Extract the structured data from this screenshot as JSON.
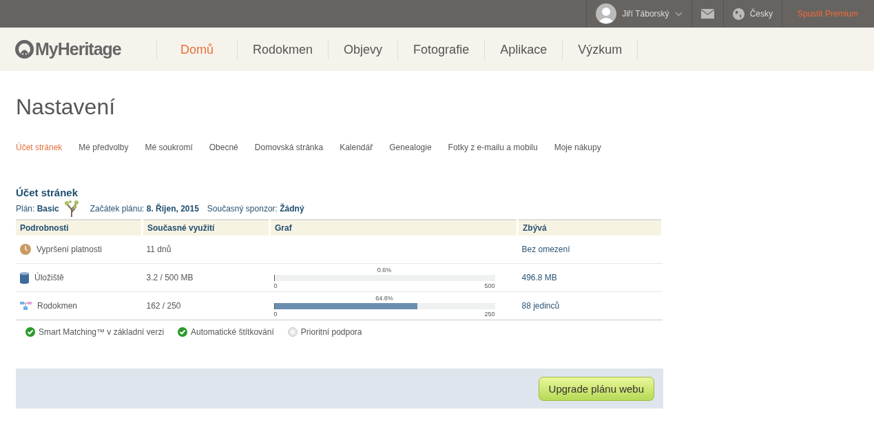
{
  "topbar": {
    "user": "Jiří Táborský",
    "language": "Česky",
    "premium": "Spustit Premium"
  },
  "logo": "MyHeritage",
  "nav": [
    {
      "label": "Domů",
      "selected": true
    },
    {
      "label": "Rodokmen",
      "selected": false
    },
    {
      "label": "Objevy",
      "selected": false
    },
    {
      "label": "Fotografie",
      "selected": false
    },
    {
      "label": "Aplikace",
      "selected": false
    },
    {
      "label": "Výzkum",
      "selected": false
    }
  ],
  "title": "Nastavení",
  "tabs": [
    {
      "label": "Účet stránek",
      "selected": true
    },
    {
      "label": "Mé předvolby",
      "selected": false
    },
    {
      "label": "Mé soukromí",
      "selected": false
    },
    {
      "label": "Obecné",
      "selected": false
    },
    {
      "label": "Domovská stránka",
      "selected": false
    },
    {
      "label": "Kalendář",
      "selected": false
    },
    {
      "label": "Genealogie",
      "selected": false
    },
    {
      "label": "Fotky z e-mailu a mobilu",
      "selected": false
    },
    {
      "label": "Moje nákupy",
      "selected": false
    }
  ],
  "section": {
    "title": "Účet stránek",
    "plan_label": "Plán:",
    "plan": "Basic",
    "start_label": "Začátek plánu:",
    "start": "8. Říjen, 2015",
    "sponsor_label": "Současný sponzor:",
    "sponsor": "Žádný"
  },
  "table": {
    "columns": [
      "Podrobnosti",
      "Současné využití",
      "Graf",
      "Zbývá"
    ],
    "rows": [
      {
        "kind": "clock",
        "name": "Vypršení platnosti",
        "usage": "11 dnů",
        "remaining": "Bez omezení"
      },
      {
        "kind": "storage",
        "name": "Úložiště",
        "usage": "3.2 / 500 MB",
        "remaining": "496.8 MB",
        "bar": {
          "percent": "0.6%",
          "level": 0.006,
          "min": "0",
          "max": "500"
        }
      },
      {
        "kind": "tree",
        "name": "Rodokmen",
        "usage": "162 / 250",
        "remaining": "88 jedinců",
        "bar": {
          "percent": "64.8%",
          "level": 0.648,
          "min": "0",
          "max": "250"
        }
      }
    ]
  },
  "features": [
    {
      "label": "Smart Matching™ v základní verzi",
      "checked": true
    },
    {
      "label": "Automatické štítkování",
      "checked": true
    },
    {
      "label": "Prioritní podpora",
      "checked": false
    }
  ],
  "upgrade_button": "Upgrade plánu webu"
}
